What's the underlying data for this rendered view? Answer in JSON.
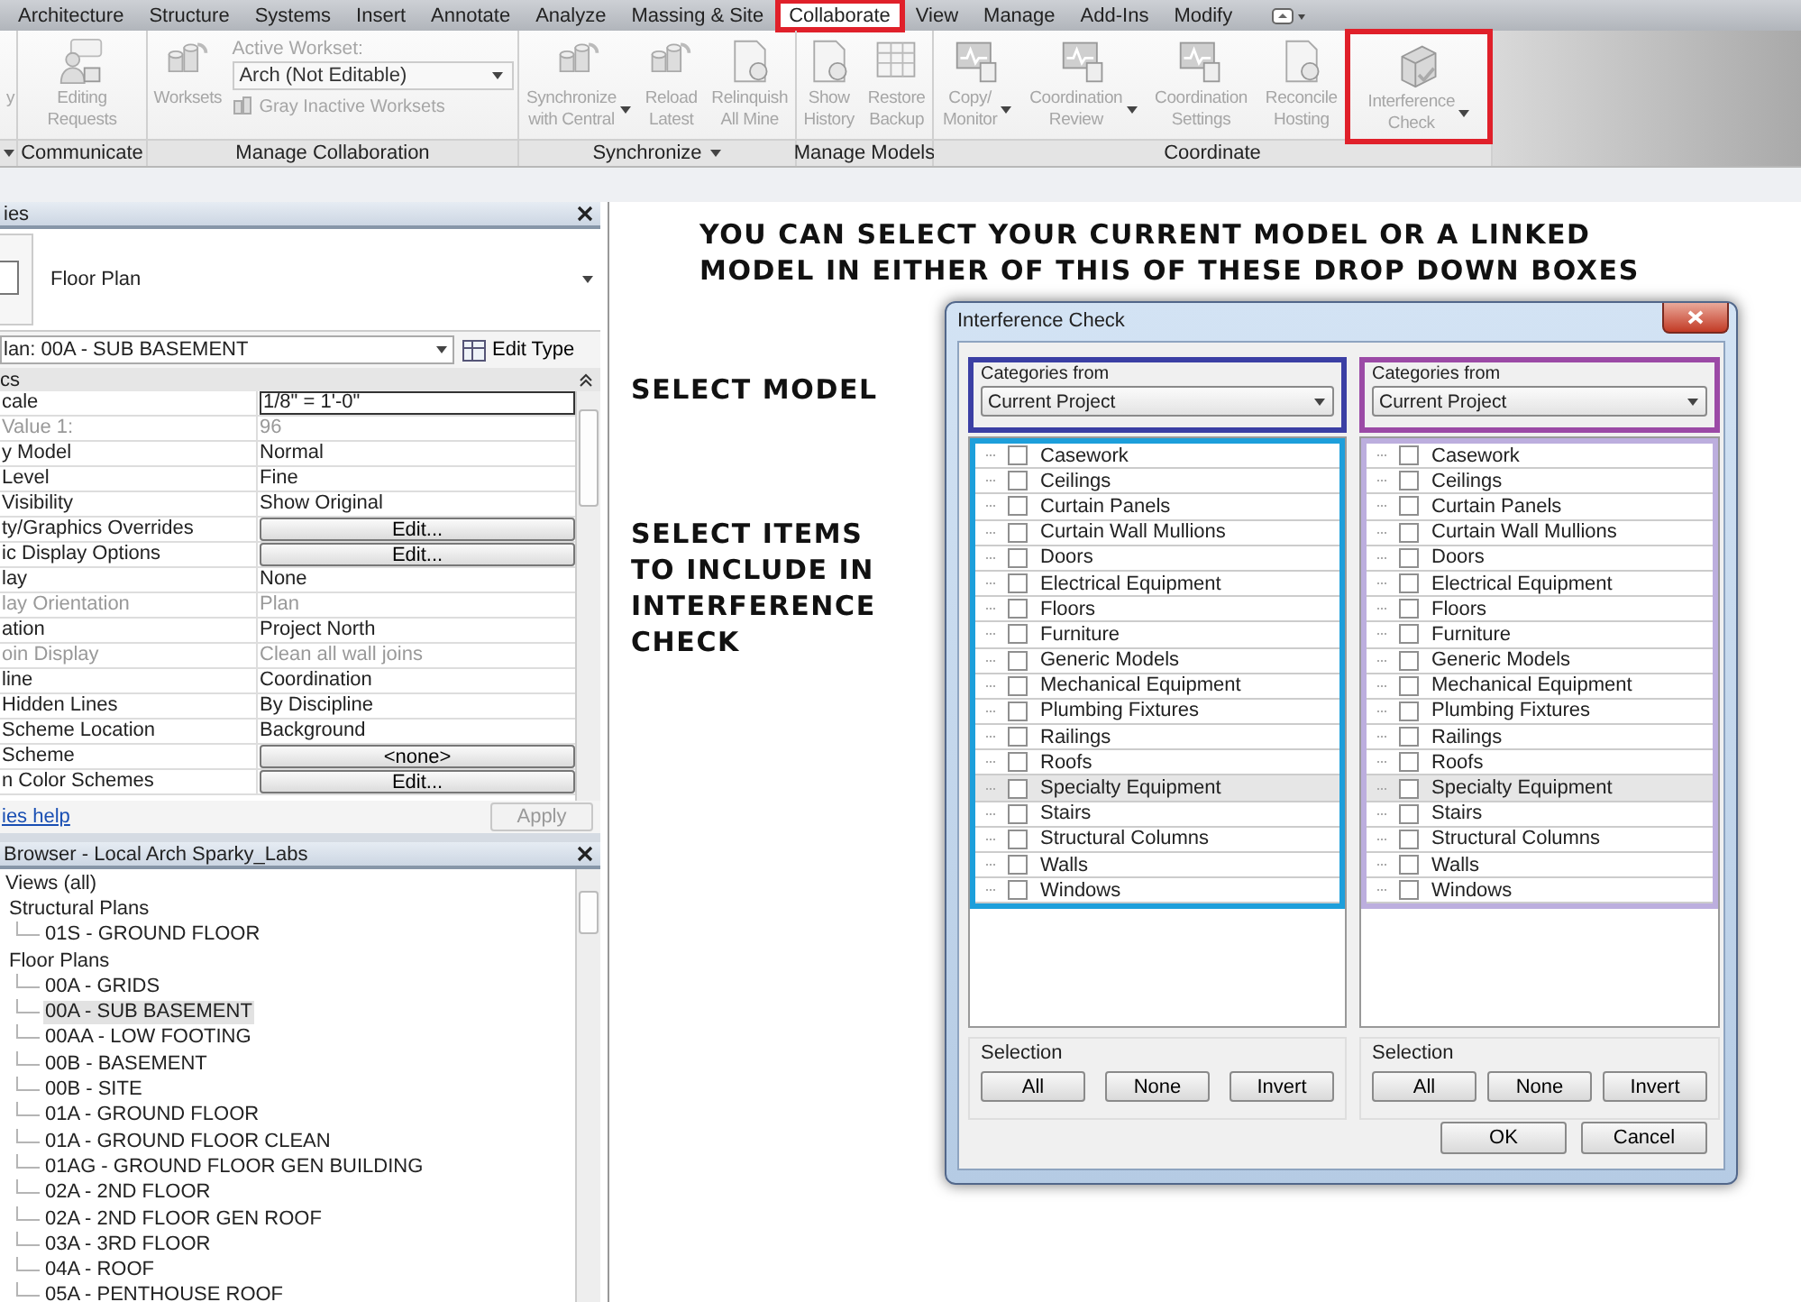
{
  "tabs": [
    {
      "label": "Architecture",
      "selected": false,
      "highlighted": false
    },
    {
      "label": "Structure",
      "selected": false,
      "highlighted": false
    },
    {
      "label": "Systems",
      "selected": false,
      "highlighted": false
    },
    {
      "label": "Insert",
      "selected": false,
      "highlighted": false
    },
    {
      "label": "Annotate",
      "selected": false,
      "highlighted": false
    },
    {
      "label": "Analyze",
      "selected": false,
      "highlighted": false
    },
    {
      "label": "Massing & Site",
      "selected": false,
      "highlighted": false
    },
    {
      "label": "Collaborate",
      "selected": true,
      "highlighted": true
    },
    {
      "label": "View",
      "selected": false,
      "highlighted": false
    },
    {
      "label": "Manage",
      "selected": false,
      "highlighted": false
    },
    {
      "label": "Add-Ins",
      "selected": false,
      "highlighted": false
    },
    {
      "label": "Modify",
      "selected": false,
      "highlighted": false
    }
  ],
  "ribbon": {
    "panels": [
      {
        "kind": "buttons",
        "menu": true,
        "buttons": [
          {
            "lines": [
              "y"
            ],
            "disabled": true,
            "has_menu": false,
            "highlighted": false
          }
        ]
      },
      {
        "kind": "buttons",
        "title": "Communicate",
        "menu": false,
        "buttons": [
          {
            "lines": [
              "Editing",
              "Requests"
            ],
            "disabled": true,
            "has_menu": false,
            "highlighted": false
          }
        ]
      },
      {
        "kind": "worksets",
        "title": "Manage Collaboration",
        "menu": false,
        "buttons": [
          {
            "lines": [
              "Worksets"
            ],
            "disabled": true,
            "has_menu": false,
            "highlighted": false
          }
        ],
        "workset_label": "Active Workset:",
        "workset_value": "Arch (Not Editable)",
        "gray_toggle": "Gray Inactive Worksets"
      },
      {
        "kind": "buttons",
        "title": "Synchronize",
        "menu": true,
        "buttons": [
          {
            "lines": [
              "Synchronize",
              "with Central"
            ],
            "disabled": true,
            "has_menu": true,
            "highlighted": false
          },
          {
            "lines": [
              "Reload",
              "Latest"
            ],
            "disabled": true,
            "has_menu": false,
            "highlighted": false
          },
          {
            "lines": [
              "Relinquish",
              "All Mine"
            ],
            "disabled": true,
            "has_menu": false,
            "highlighted": false
          }
        ]
      },
      {
        "kind": "buttons",
        "title": "Manage Models",
        "menu": false,
        "buttons": [
          {
            "lines": [
              "Show",
              "History"
            ],
            "disabled": true,
            "has_menu": false,
            "highlighted": false
          },
          {
            "lines": [
              "Restore",
              "Backup"
            ],
            "disabled": true,
            "has_menu": false,
            "highlighted": false
          }
        ]
      },
      {
        "kind": "buttons",
        "title": "Coordinate",
        "menu": false,
        "buttons": [
          {
            "lines": [
              "Copy/",
              "Monitor"
            ],
            "disabled": true,
            "has_menu": true,
            "highlighted": false
          },
          {
            "lines": [
              "Coordination",
              "Review"
            ],
            "disabled": true,
            "has_menu": true,
            "highlighted": false
          },
          {
            "lines": [
              "Coordination",
              "Settings"
            ],
            "disabled": true,
            "has_menu": false,
            "highlighted": false
          },
          {
            "lines": [
              "Reconcile",
              "Hosting"
            ],
            "disabled": true,
            "has_menu": false,
            "highlighted": false
          },
          {
            "lines": [
              "Interference",
              "Check"
            ],
            "disabled": true,
            "has_menu": true,
            "highlighted": true
          }
        ]
      }
    ]
  },
  "properties": {
    "title": "ies",
    "type_name": "Floor Plan",
    "instance": "lan: 00A - SUB BASEMENT",
    "edit_type": "Edit Type",
    "group": "cs",
    "rows": [
      {
        "label": "cale",
        "value": "1/8\" = 1'-0\"",
        "kind": "field",
        "disabled": false
      },
      {
        "label": "Value   1:",
        "value": "96",
        "kind": "text",
        "disabled": true
      },
      {
        "label": "y Model",
        "value": "Normal",
        "kind": "text",
        "disabled": false
      },
      {
        "label": "Level",
        "value": "Fine",
        "kind": "text",
        "disabled": false
      },
      {
        "label": "Visibility",
        "value": "Show Original",
        "kind": "text",
        "disabled": false
      },
      {
        "label": "ty/Graphics Overrides",
        "value": "Edit...",
        "kind": "button",
        "disabled": false
      },
      {
        "label": "ic Display Options",
        "value": "Edit...",
        "kind": "button",
        "disabled": false
      },
      {
        "label": "lay",
        "value": "None",
        "kind": "text",
        "disabled": false
      },
      {
        "label": "lay Orientation",
        "value": "Plan",
        "kind": "text",
        "disabled": true
      },
      {
        "label": "ation",
        "value": "Project North",
        "kind": "text",
        "disabled": false
      },
      {
        "label": "oin Display",
        "value": "Clean all wall joins",
        "kind": "text",
        "disabled": true
      },
      {
        "label": "line",
        "value": "Coordination",
        "kind": "text",
        "disabled": false
      },
      {
        "label": "Hidden Lines",
        "value": "By Discipline",
        "kind": "text",
        "disabled": false
      },
      {
        "label": "Scheme Location",
        "value": "Background",
        "kind": "text",
        "disabled": false
      },
      {
        "label": "Scheme",
        "value": "<none>",
        "kind": "button",
        "disabled": false
      },
      {
        "label": "n Color Schemes",
        "value": "Edit...",
        "kind": "button",
        "disabled": false
      }
    ],
    "help": "ies help",
    "apply": "Apply",
    "apply_disabled": true
  },
  "browser": {
    "title": "Browser - Local Arch Sparky_Labs",
    "tree": [
      {
        "label": "Views (all)",
        "selected": false,
        "children": [
          {
            "label": "Structural Plans",
            "selected": false,
            "children": [
              {
                "label": "01S - GROUND FLOOR",
                "selected": false
              }
            ]
          },
          {
            "label": "Floor Plans",
            "selected": false,
            "children": [
              {
                "label": "00A - GRIDS",
                "selected": false
              },
              {
                "label": "00A - SUB BASEMENT",
                "selected": true
              },
              {
                "label": "00AA - LOW FOOTING",
                "selected": false
              },
              {
                "label": "00B - BASEMENT",
                "selected": false
              },
              {
                "label": "00B - SITE",
                "selected": false
              },
              {
                "label": "01A - GROUND FLOOR",
                "selected": false
              },
              {
                "label": "01A - GROUND FLOOR CLEAN",
                "selected": false
              },
              {
                "label": "01AG - GROUND FLOOR GEN BUILDING",
                "selected": false
              },
              {
                "label": "02A - 2ND FLOOR",
                "selected": false
              },
              {
                "label": "02A - 2ND FLOOR GEN ROOF",
                "selected": false
              },
              {
                "label": "03A - 3RD FLOOR",
                "selected": false
              },
              {
                "label": "04A - ROOF",
                "selected": false
              },
              {
                "label": "05A - PENTHOUSE ROOF",
                "selected": false
              }
            ]
          }
        ]
      }
    ]
  },
  "notes": [
    {
      "lines": [
        "YOU CAN SELECT YOUR CURRENT MODEL OR A LINKED",
        "MODEL IN EITHER OF THIS OF THESE DROP DOWN BOXES"
      ]
    },
    {
      "lines": [
        "SELECT MODEL"
      ]
    },
    {
      "lines": [
        "SELECT ITEMS",
        "TO INCLUDE IN",
        "INTERFERENCE",
        "CHECK"
      ]
    }
  ],
  "dialog": {
    "title": "Interference Check",
    "columns": [
      {
        "categories_label": "Categories from",
        "source": "Current Project",
        "selection_label": "Selection",
        "buttons": [
          "All",
          "None",
          "Invert"
        ],
        "items": [
          {
            "label": "Casework",
            "checked": false,
            "selected": false
          },
          {
            "label": "Ceilings",
            "checked": false,
            "selected": false
          },
          {
            "label": "Curtain Panels",
            "checked": false,
            "selected": false
          },
          {
            "label": "Curtain Wall Mullions",
            "checked": false,
            "selected": false
          },
          {
            "label": "Doors",
            "checked": false,
            "selected": false
          },
          {
            "label": "Electrical Equipment",
            "checked": false,
            "selected": false
          },
          {
            "label": "Floors",
            "checked": false,
            "selected": false
          },
          {
            "label": "Furniture",
            "checked": false,
            "selected": false
          },
          {
            "label": "Generic Models",
            "checked": false,
            "selected": false
          },
          {
            "label": "Mechanical Equipment",
            "checked": false,
            "selected": false
          },
          {
            "label": "Plumbing Fixtures",
            "checked": false,
            "selected": false
          },
          {
            "label": "Railings",
            "checked": false,
            "selected": false
          },
          {
            "label": "Roofs",
            "checked": false,
            "selected": false
          },
          {
            "label": "Specialty Equipment",
            "checked": false,
            "selected": true
          },
          {
            "label": "Stairs",
            "checked": false,
            "selected": false
          },
          {
            "label": "Structural Columns",
            "checked": false,
            "selected": false
          },
          {
            "label": "Walls",
            "checked": false,
            "selected": false
          },
          {
            "label": "Windows",
            "checked": false,
            "selected": false
          }
        ]
      },
      {
        "categories_label": "Categories from",
        "source": "Current Project",
        "selection_label": "Selection",
        "buttons": [
          "All",
          "None",
          "Invert"
        ],
        "items": [
          {
            "label": "Casework",
            "checked": false,
            "selected": false
          },
          {
            "label": "Ceilings",
            "checked": false,
            "selected": false
          },
          {
            "label": "Curtain Panels",
            "checked": false,
            "selected": false
          },
          {
            "label": "Curtain Wall Mullions",
            "checked": false,
            "selected": false
          },
          {
            "label": "Doors",
            "checked": false,
            "selected": false
          },
          {
            "label": "Electrical Equipment",
            "checked": false,
            "selected": false
          },
          {
            "label": "Floors",
            "checked": false,
            "selected": false
          },
          {
            "label": "Furniture",
            "checked": false,
            "selected": false
          },
          {
            "label": "Generic Models",
            "checked": false,
            "selected": false
          },
          {
            "label": "Mechanical Equipment",
            "checked": false,
            "selected": false
          },
          {
            "label": "Plumbing Fixtures",
            "checked": false,
            "selected": false
          },
          {
            "label": "Railings",
            "checked": false,
            "selected": false
          },
          {
            "label": "Roofs",
            "checked": false,
            "selected": false
          },
          {
            "label": "Specialty Equipment",
            "checked": false,
            "selected": true
          },
          {
            "label": "Stairs",
            "checked": false,
            "selected": false
          },
          {
            "label": "Structural Columns",
            "checked": false,
            "selected": false
          },
          {
            "label": "Walls",
            "checked": false,
            "selected": false
          },
          {
            "label": "Windows",
            "checked": false,
            "selected": false
          }
        ]
      }
    ],
    "buttons": [
      "OK",
      "Cancel"
    ]
  }
}
